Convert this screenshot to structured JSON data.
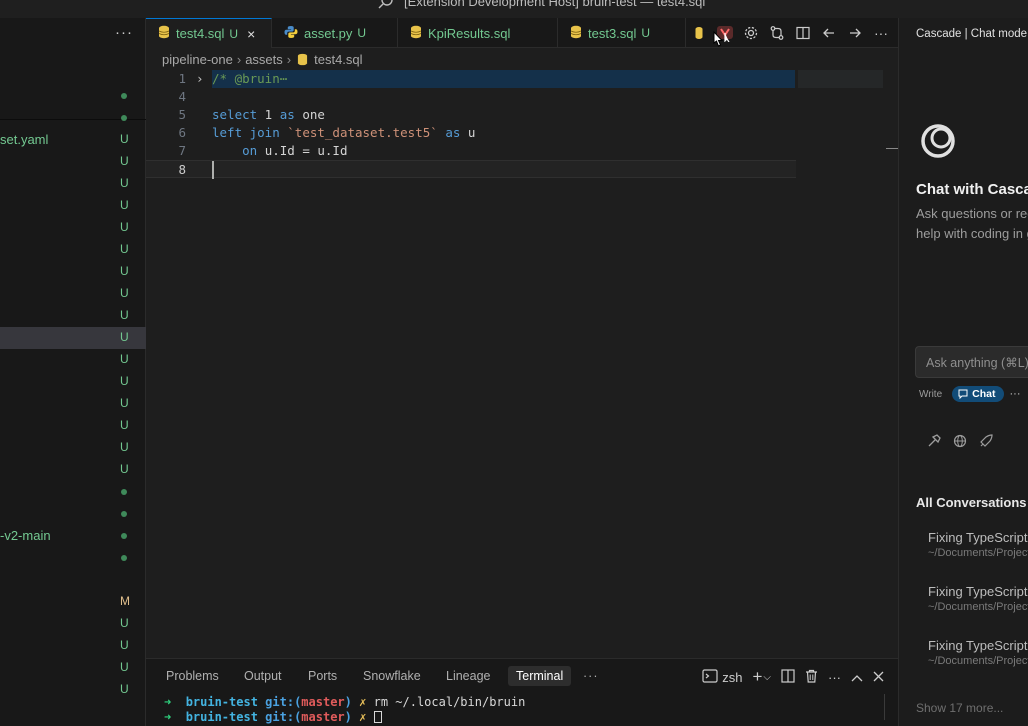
{
  "window": {
    "title": "[Extension Development Host] bruin-test — test4.sql"
  },
  "explorer": {
    "more": "···",
    "rows": [
      {
        "name": "",
        "status": "dot"
      },
      {
        "name": "",
        "status": "dot"
      },
      {
        "name": "set.yaml",
        "status": "U"
      },
      {
        "name": "",
        "status": "U"
      },
      {
        "name": "",
        "status": "U"
      },
      {
        "name": "",
        "status": "U"
      },
      {
        "name": "",
        "status": "U"
      },
      {
        "name": "",
        "status": "U"
      },
      {
        "name": "",
        "status": "U"
      },
      {
        "name": "",
        "status": "U"
      },
      {
        "name": "",
        "status": "U"
      },
      {
        "name": "",
        "status": "U",
        "selected": true
      },
      {
        "name": "",
        "status": "U"
      },
      {
        "name": "",
        "status": "U"
      },
      {
        "name": "",
        "status": "U"
      },
      {
        "name": "",
        "status": "U"
      },
      {
        "name": "",
        "status": "U"
      },
      {
        "name": "",
        "status": "U"
      },
      {
        "name": "",
        "status": "dot"
      },
      {
        "name": "",
        "status": "dot"
      },
      {
        "name": "-v2-main",
        "status": "dot"
      },
      {
        "name": "",
        "status": "dot"
      },
      {
        "name": "",
        "status": "none"
      },
      {
        "name": "",
        "status": "M"
      },
      {
        "name": "",
        "status": "U"
      },
      {
        "name": "",
        "status": "U"
      },
      {
        "name": "",
        "status": "U"
      },
      {
        "name": "",
        "status": "U"
      }
    ]
  },
  "tabs": [
    {
      "label": "test4.sql",
      "status": "U",
      "active": true,
      "icon": "database-icon"
    },
    {
      "label": "asset.py",
      "status": "U",
      "active": false,
      "icon": "python-icon"
    },
    {
      "label": "KpiResults.sql",
      "status": "",
      "active": false,
      "icon": "database-icon"
    },
    {
      "label": "test3.sql",
      "status": "U",
      "active": false,
      "icon": "database-icon"
    }
  ],
  "tab_close": "×",
  "breadcrumb": {
    "parts": [
      "pipeline-one",
      "assets",
      "test4.sql"
    ]
  },
  "editor": {
    "lines": [
      {
        "num": "1",
        "tokens": [
          [
            "cm",
            "/* @bruin"
          ],
          [
            "cm",
            "⋯"
          ]
        ],
        "fold": true
      },
      {
        "num": "4",
        "tokens": []
      },
      {
        "num": "5",
        "tokens": [
          [
            "kw",
            "select"
          ],
          [
            "tx",
            " 1 "
          ],
          [
            "kw",
            "as"
          ],
          [
            "tx",
            " one"
          ]
        ]
      },
      {
        "num": "6",
        "tokens": [
          [
            "kw",
            "left join"
          ],
          [
            "tx",
            " "
          ],
          [
            "st",
            "`test_dataset.test5`"
          ],
          [
            "tx",
            " "
          ],
          [
            "kw",
            "as"
          ],
          [
            "tx",
            " u"
          ]
        ]
      },
      {
        "num": "7",
        "tokens": [
          [
            "tx",
            "    "
          ],
          [
            "kw",
            "on"
          ],
          [
            "tx",
            " u.Id = u.Id"
          ]
        ]
      },
      {
        "num": "8",
        "tokens": [],
        "current": true
      }
    ]
  },
  "chat": {
    "header": "Cascade | Chat mode",
    "heading": "Chat with Cascade",
    "description": "Ask questions or request help with coding in general",
    "input_placeholder": "Ask anything (⌘L)",
    "mode_write": "Write",
    "mode_chat": "Chat",
    "mode_more": "···",
    "section": "All Conversations",
    "conversations": [
      {
        "title": "Fixing TypeScript",
        "path": "~/Documents/Projects"
      },
      {
        "title": "Fixing TypeScript",
        "path": "~/Documents/Projects"
      },
      {
        "title": "Fixing TypeScript",
        "path": "~/Documents/Projects"
      }
    ],
    "show_more": "Show 17 more..."
  },
  "panel": {
    "tabs": [
      "Problems",
      "Output",
      "Ports",
      "Snowflake",
      "Lineage",
      "Terminal"
    ],
    "active_tab": "Terminal",
    "more": "···",
    "shell": "zsh",
    "terminal": [
      {
        "arrow": "➜",
        "dir": "bruin-test",
        "git": "git:(",
        "branch": "master",
        "gitclose": ")",
        "x": "✗",
        "cmd": "rm ~/.local/bin/bruin"
      },
      {
        "arrow": "➜",
        "dir": "bruin-test",
        "git": "git:(",
        "branch": "master",
        "gitclose": ")",
        "x": "✗",
        "cmd": ""
      }
    ]
  },
  "colors": {
    "accent": "#0078d4",
    "git_untracked": "#73c991",
    "git_modified": "#e2c08d",
    "chat_mode": "#124c78"
  }
}
